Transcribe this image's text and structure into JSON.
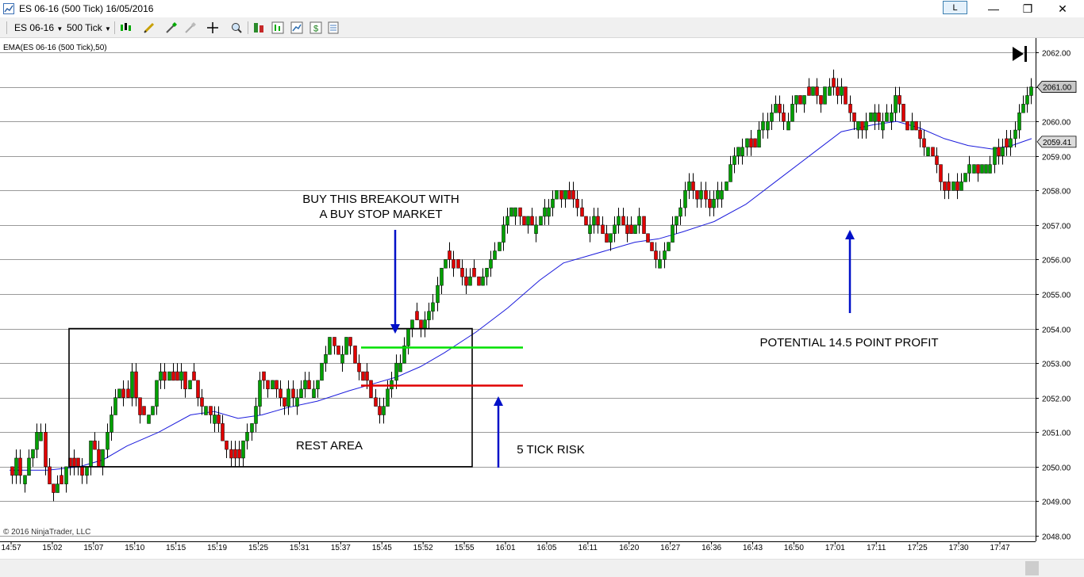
{
  "window": {
    "title": "ES 06-16 (500 Tick)  16/05/2016",
    "link_label": "L",
    "minimize": "—",
    "maximize": "❐",
    "close": "✕"
  },
  "toolbar": {
    "instrument": "ES 06-16",
    "interval": "500 Tick"
  },
  "colors": {
    "up_candle": "#00a000",
    "down_candle": "#e00000",
    "ema": "#1c1cdc",
    "arrow": "#0010c8",
    "entry_line": "#00e000",
    "stop_line": "#e00000",
    "box": "#000000",
    "grid": "#9a9a9a"
  },
  "chart_data": {
    "type": "candlestick",
    "title": "",
    "indicator_label": "EMA(ES 06-16 (500 Tick),50)",
    "copyright": "© 2016 NinjaTrader, LLC",
    "ylim": [
      2048.0,
      2062.0
    ],
    "y_ticks": [
      "2062.00",
      "2061.00",
      "2060.00",
      "2059.00",
      "2058.00",
      "2057.00",
      "2056.00",
      "2055.00",
      "2054.00",
      "2053.00",
      "2052.00",
      "2051.00",
      "2050.00",
      "2049.00",
      "2048.00"
    ],
    "x_ticks": [
      "14:57",
      "15:02",
      "15:07",
      "15:10",
      "15:15",
      "15:19",
      "15:25",
      "15:31",
      "15:37",
      "15:45",
      "15:52",
      "15:55",
      "16:01",
      "16:05",
      "16:11",
      "16:20",
      "16:27",
      "16:36",
      "16:43",
      "16:50",
      "17:01",
      "17:11",
      "17:25",
      "17:30",
      "17:47"
    ],
    "last_price": "2061.00",
    "ema_last": "2059.41",
    "price_path": [
      [
        14.5,
        2049.75
      ],
      [
        20,
        2050.25
      ],
      [
        28,
        2049.5
      ],
      [
        40,
        2050.5
      ],
      [
        50,
        2051.5
      ],
      [
        55,
        2050.0
      ],
      [
        65,
        2049.25
      ],
      [
        75,
        2049.5
      ],
      [
        85,
        2050.0
      ],
      [
        95,
        2050.0
      ],
      [
        105,
        2049.75
      ],
      [
        115,
        2050.75
      ],
      [
        125,
        2050.0
      ],
      [
        135,
        2051.0
      ],
      [
        145,
        2052.0
      ],
      [
        150,
        2052.25
      ],
      [
        158,
        2051.75
      ],
      [
        165,
        2052.75
      ],
      [
        172,
        2051.75
      ],
      [
        180,
        2051.5
      ],
      [
        190,
        2051.5
      ],
      [
        195,
        2052.25
      ],
      [
        200,
        2052.75
      ],
      [
        205,
        2052.5
      ],
      [
        212,
        2052.75
      ],
      [
        220,
        2052.5
      ],
      [
        228,
        2052.75
      ],
      [
        235,
        2052.25
      ],
      [
        242,
        2052.75
      ],
      [
        250,
        2051.75
      ],
      [
        258,
        2051.75
      ],
      [
        268,
        2051.5
      ],
      [
        278,
        2051.0
      ],
      [
        285,
        2050.5
      ],
      [
        292,
        2050.25
      ],
      [
        300,
        2050.25
      ],
      [
        308,
        2050.75
      ],
      [
        315,
        2051.25
      ],
      [
        322,
        2051.75
      ],
      [
        330,
        2052.75
      ],
      [
        338,
        2052.25
      ],
      [
        345,
        2052.5
      ],
      [
        352,
        2052.0
      ],
      [
        358,
        2051.75
      ],
      [
        365,
        2052.25
      ],
      [
        372,
        2052.0
      ],
      [
        378,
        2052.25
      ],
      [
        385,
        2052.5
      ],
      [
        392,
        2052.0
      ],
      [
        400,
        2052.5
      ],
      [
        405,
        2053.0
      ],
      [
        410,
        2053.25
      ],
      [
        415,
        2053.75
      ],
      [
        420,
        2053.5
      ],
      [
        425,
        2053.25
      ],
      [
        430,
        2053.0
      ],
      [
        435,
        2053.75
      ],
      [
        440,
        2053.5
      ],
      [
        445,
        2053.25
      ],
      [
        450,
        2052.75
      ],
      [
        455,
        2052.5
      ],
      [
        460,
        2052.75
      ],
      [
        465,
        2052.0
      ],
      [
        470,
        2052.0
      ],
      [
        475,
        2051.75
      ],
      [
        480,
        2051.5
      ],
      [
        485,
        2052.0
      ],
      [
        490,
        2052.25
      ],
      [
        495,
        2052.75
      ],
      [
        500,
        2053.0
      ],
      [
        505,
        2053.0
      ],
      [
        510,
        2053.5
      ],
      [
        515,
        2054.0
      ],
      [
        520,
        2054.25
      ],
      [
        525,
        2054.25
      ],
      [
        530,
        2054.0
      ],
      [
        535,
        2054.25
      ],
      [
        540,
        2054.5
      ],
      [
        545,
        2054.75
      ],
      [
        550,
        2055.25
      ],
      [
        555,
        2055.75
      ],
      [
        560,
        2056.0
      ],
      [
        565,
        2056.0
      ],
      [
        570,
        2055.75
      ],
      [
        575,
        2055.75
      ],
      [
        580,
        2055.5
      ],
      [
        585,
        2055.25
      ],
      [
        590,
        2055.5
      ],
      [
        595,
        2055.5
      ],
      [
        600,
        2055.25
      ],
      [
        605,
        2055.25
      ],
      [
        610,
        2055.5
      ],
      [
        615,
        2055.75
      ],
      [
        620,
        2056.0
      ],
      [
        625,
        2056.25
      ],
      [
        630,
        2056.5
      ],
      [
        635,
        2057.0
      ],
      [
        640,
        2057.25
      ],
      [
        645,
        2057.5
      ],
      [
        650,
        2057.5
      ],
      [
        655,
        2057.25
      ],
      [
        660,
        2057.0
      ],
      [
        665,
        2057.25
      ],
      [
        670,
        2057.0
      ],
      [
        675,
        2057.0
      ],
      [
        680,
        2057.25
      ],
      [
        685,
        2057.5
      ],
      [
        690,
        2057.5
      ],
      [
        695,
        2057.75
      ],
      [
        700,
        2058.0
      ],
      [
        705,
        2057.75
      ],
      [
        710,
        2058.0
      ],
      [
        715,
        2057.75
      ],
      [
        720,
        2057.75
      ],
      [
        725,
        2057.5
      ],
      [
        730,
        2057.25
      ],
      [
        735,
        2057.25
      ],
      [
        740,
        2057.0
      ],
      [
        745,
        2057.0
      ],
      [
        750,
        2057.25
      ],
      [
        755,
        2056.75
      ],
      [
        760,
        2056.75
      ],
      [
        765,
        2056.5
      ],
      [
        770,
        2056.75
      ],
      [
        775,
        2057.0
      ],
      [
        780,
        2057.25
      ],
      [
        785,
        2057.0
      ],
      [
        790,
        2056.75
      ],
      [
        795,
        2056.75
      ],
      [
        800,
        2057.0
      ],
      [
        805,
        2057.25
      ],
      [
        810,
        2056.75
      ],
      [
        815,
        2056.5
      ],
      [
        820,
        2056.25
      ],
      [
        825,
        2056.0
      ],
      [
        830,
        2056.0
      ],
      [
        835,
        2056.25
      ],
      [
        840,
        2056.5
      ],
      [
        845,
        2056.75
      ],
      [
        850,
        2057.25
      ],
      [
        855,
        2057.5
      ],
      [
        860,
        2057.75
      ],
      [
        865,
        2058.0
      ],
      [
        870,
        2058.25
      ],
      [
        875,
        2058.0
      ],
      [
        880,
        2057.75
      ],
      [
        885,
        2058.0
      ],
      [
        890,
        2057.75
      ],
      [
        895,
        2057.5
      ],
      [
        900,
        2057.75
      ],
      [
        905,
        2058.0
      ],
      [
        910,
        2058.0
      ],
      [
        915,
        2058.25
      ],
      [
        920,
        2058.75
      ],
      [
        925,
        2059.0
      ],
      [
        930,
        2059.25
      ],
      [
        935,
        2059.25
      ],
      [
        940,
        2059.5
      ],
      [
        945,
        2059.25
      ],
      [
        950,
        2059.25
      ],
      [
        955,
        2059.75
      ],
      [
        960,
        2060.0
      ],
      [
        965,
        2060.0
      ],
      [
        970,
        2060.25
      ],
      [
        975,
        2060.5
      ],
      [
        980,
        2060.25
      ],
      [
        985,
        2060.0
      ],
      [
        990,
        2059.75
      ],
      [
        995,
        2060.25
      ],
      [
        1000,
        2060.75
      ],
      [
        1005,
        2060.75
      ],
      [
        1010,
        2060.5
      ],
      [
        1015,
        2060.75
      ],
      [
        1020,
        2060.75
      ],
      [
        1025,
        2061.0
      ],
      [
        1030,
        2060.75
      ],
      [
        1035,
        2060.5
      ],
      [
        1040,
        2061.0
      ],
      [
        1045,
        2061.0
      ],
      [
        1050,
        2061.0
      ],
      [
        1055,
        2060.75
      ],
      [
        1060,
        2061.0
      ],
      [
        1065,
        2060.5
      ],
      [
        1070,
        2060.25
      ],
      [
        1075,
        2060.0
      ],
      [
        1080,
        2060.0
      ],
      [
        1085,
        2059.75
      ],
      [
        1090,
        2060.0
      ],
      [
        1095,
        2060.25
      ],
      [
        1100,
        2060.25
      ],
      [
        1105,
        2060.0
      ],
      [
        1110,
        2060.0
      ],
      [
        1115,
        2060.25
      ],
      [
        1120,
        2060.0
      ],
      [
        1125,
        2060.5
      ],
      [
        1130,
        2061.0
      ],
      [
        1135,
        2060.25
      ],
      [
        1140,
        2060.0
      ],
      [
        1145,
        2059.75
      ],
      [
        1150,
        2060.0
      ],
      [
        1155,
        2059.75
      ],
      [
        1160,
        2059.5
      ],
      [
        1165,
        2059.25
      ],
      [
        1170,
        2059.25
      ],
      [
        1175,
        2059.0
      ],
      [
        1180,
        2058.75
      ],
      [
        1185,
        2058.25
      ],
      [
        1190,
        2058.0
      ],
      [
        1195,
        2058.0
      ],
      [
        1200,
        2058.25
      ],
      [
        1205,
        2058.0
      ],
      [
        1210,
        2058.25
      ],
      [
        1215,
        2058.5
      ],
      [
        1220,
        2058.75
      ],
      [
        1225,
        2058.75
      ],
      [
        1230,
        2058.5
      ],
      [
        1235,
        2058.75
      ],
      [
        1240,
        2058.75
      ],
      [
        1245,
        2058.5
      ],
      [
        1250,
        2059.0
      ],
      [
        1255,
        2059.25
      ],
      [
        1260,
        2059.0
      ],
      [
        1265,
        2059.25
      ],
      [
        1270,
        2059.25
      ],
      [
        1275,
        2059.5
      ],
      [
        1280,
        2060.0
      ],
      [
        1285,
        2060.25
      ],
      [
        1290,
        2060.5
      ],
      [
        1295,
        2060.75
      ],
      [
        1300,
        2061.0
      ]
    ],
    "ema_path": [
      [
        12,
        2049.9
      ],
      [
        60,
        2049.9
      ],
      [
        100,
        2050.0
      ],
      [
        130,
        2050.2
      ],
      [
        160,
        2050.6
      ],
      [
        200,
        2051.0
      ],
      [
        240,
        2051.5
      ],
      [
        270,
        2051.6
      ],
      [
        300,
        2051.4
      ],
      [
        330,
        2051.5
      ],
      [
        360,
        2051.7
      ],
      [
        400,
        2051.9
      ],
      [
        440,
        2052.2
      ],
      [
        470,
        2052.4
      ],
      [
        500,
        2052.6
      ],
      [
        530,
        2052.9
      ],
      [
        560,
        2053.3
      ],
      [
        600,
        2053.9
      ],
      [
        640,
        2054.6
      ],
      [
        680,
        2055.4
      ],
      [
        710,
        2055.9
      ],
      [
        740,
        2056.1
      ],
      [
        770,
        2056.3
      ],
      [
        800,
        2056.5
      ],
      [
        830,
        2056.6
      ],
      [
        860,
        2056.8
      ],
      [
        900,
        2057.1
      ],
      [
        940,
        2057.6
      ],
      [
        980,
        2058.3
      ],
      [
        1020,
        2059.0
      ],
      [
        1060,
        2059.7
      ],
      [
        1100,
        2059.9
      ],
      [
        1130,
        2060.0
      ],
      [
        1160,
        2059.8
      ],
      [
        1190,
        2059.5
      ],
      [
        1220,
        2059.3
      ],
      [
        1250,
        2059.2
      ],
      [
        1275,
        2059.3
      ],
      [
        1300,
        2059.5
      ]
    ],
    "annotations": {
      "rest_area": {
        "label": "REST AREA",
        "x_from": 87,
        "x_to": 595,
        "y_low": 2050.0,
        "y_high": 2054.0
      },
      "entry_level": {
        "price": 2053.45
      },
      "stop_level": {
        "price": 2052.35
      },
      "buy_note": [
        "BUY THIS BREAKOUT WITH",
        "A BUY STOP MARKET"
      ],
      "risk_note": "5 TICK RISK",
      "profit_note": "POTENTIAL 14.5 POINT PROFIT"
    }
  }
}
